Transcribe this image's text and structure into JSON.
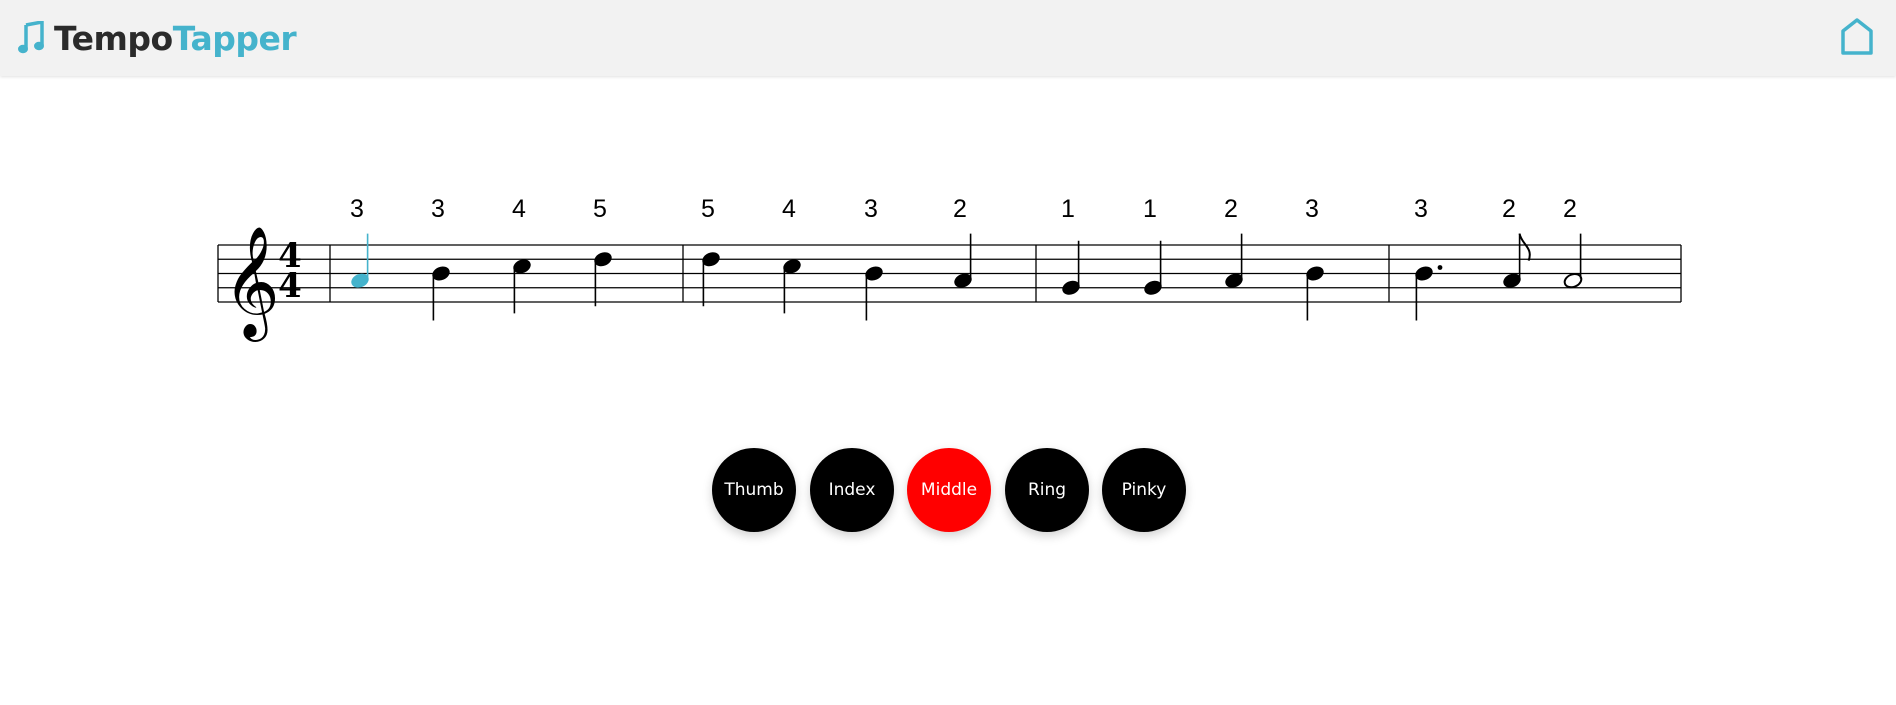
{
  "app": {
    "brand_part1": "Tempo",
    "brand_part2": "Tapper",
    "brand_icon": "music-note-icon",
    "home_icon": "home-icon"
  },
  "colors": {
    "accent": "#45b3cc",
    "active_button": "#ff0000",
    "button": "#000000",
    "header_bg": "#f2f2f2",
    "current_note": "#45b3cc"
  },
  "score": {
    "clef": "treble",
    "time_signature": {
      "top": "4",
      "bottom": "4"
    },
    "current_note_index": 0,
    "measures": [
      {
        "notes": [
          {
            "finger": "3",
            "pitch": "A4",
            "duration": "quarter"
          },
          {
            "finger": "3",
            "pitch": "B4",
            "duration": "quarter"
          },
          {
            "finger": "4",
            "pitch": "C5",
            "duration": "quarter"
          },
          {
            "finger": "5",
            "pitch": "D5",
            "duration": "quarter"
          }
        ]
      },
      {
        "notes": [
          {
            "finger": "5",
            "pitch": "D5",
            "duration": "quarter"
          },
          {
            "finger": "4",
            "pitch": "C5",
            "duration": "quarter"
          },
          {
            "finger": "3",
            "pitch": "B4",
            "duration": "quarter"
          },
          {
            "finger": "2",
            "pitch": "A4",
            "duration": "quarter"
          }
        ]
      },
      {
        "notes": [
          {
            "finger": "1",
            "pitch": "G4",
            "duration": "quarter"
          },
          {
            "finger": "1",
            "pitch": "G4",
            "duration": "quarter"
          },
          {
            "finger": "2",
            "pitch": "A4",
            "duration": "quarter"
          },
          {
            "finger": "3",
            "pitch": "B4",
            "duration": "quarter"
          }
        ]
      },
      {
        "notes": [
          {
            "finger": "3",
            "pitch": "B4",
            "duration": "dotted-quarter"
          },
          {
            "finger": "2",
            "pitch": "A4",
            "duration": "eighth"
          },
          {
            "finger": "2",
            "pitch": "A4",
            "duration": "half"
          }
        ]
      }
    ]
  },
  "finger_buttons": [
    {
      "label": "Thumb",
      "active": false
    },
    {
      "label": "Index",
      "active": false
    },
    {
      "label": "Middle",
      "active": true
    },
    {
      "label": "Ring",
      "active": false
    },
    {
      "label": "Pinky",
      "active": false
    }
  ]
}
